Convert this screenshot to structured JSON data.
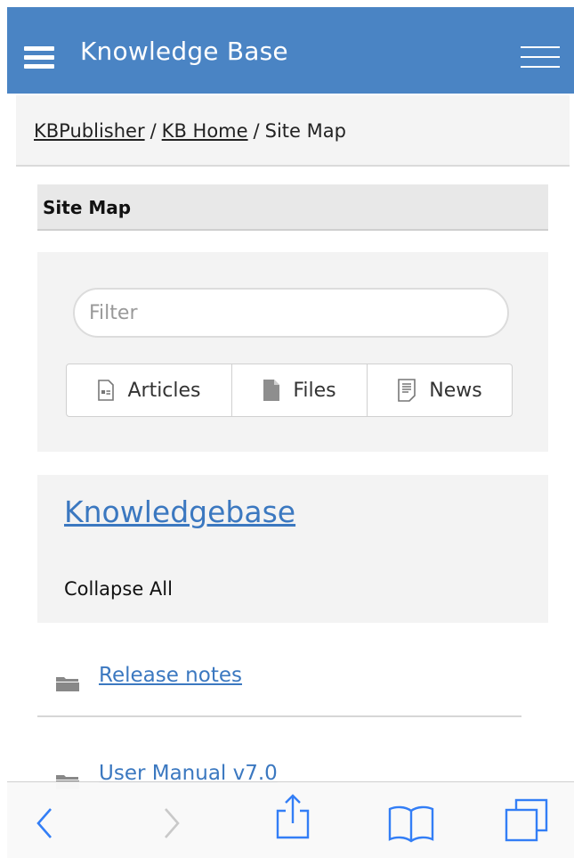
{
  "header": {
    "title": "Knowledge Base",
    "menu_icon": "hamburger-icon",
    "right_menu_icon": "menu-lines-icon",
    "color": "#4a84c4"
  },
  "breadcrumb": {
    "items": [
      "KBPublisher",
      "KB Home"
    ],
    "current": "Site Map",
    "separator": "/"
  },
  "section": {
    "title": "Site Map"
  },
  "filter": {
    "placeholder": "Filter",
    "value": "",
    "tabs": [
      {
        "label": "Articles",
        "icon": "article-icon"
      },
      {
        "label": "Files",
        "icon": "file-icon"
      },
      {
        "label": "News",
        "icon": "news-icon"
      }
    ]
  },
  "tree": {
    "root_label": "Knowledgebase",
    "collapse_label": "Collapse All",
    "items": [
      {
        "label": "Release notes",
        "icon": "folder-icon"
      },
      {
        "label": "User Manual v7.0",
        "icon": "folder-icon"
      }
    ]
  },
  "browser_toolbar": {
    "icons": [
      "back-icon",
      "forward-icon",
      "share-icon",
      "bookmarks-icon",
      "tabs-icon"
    ],
    "accent": "#2f7cf6"
  }
}
